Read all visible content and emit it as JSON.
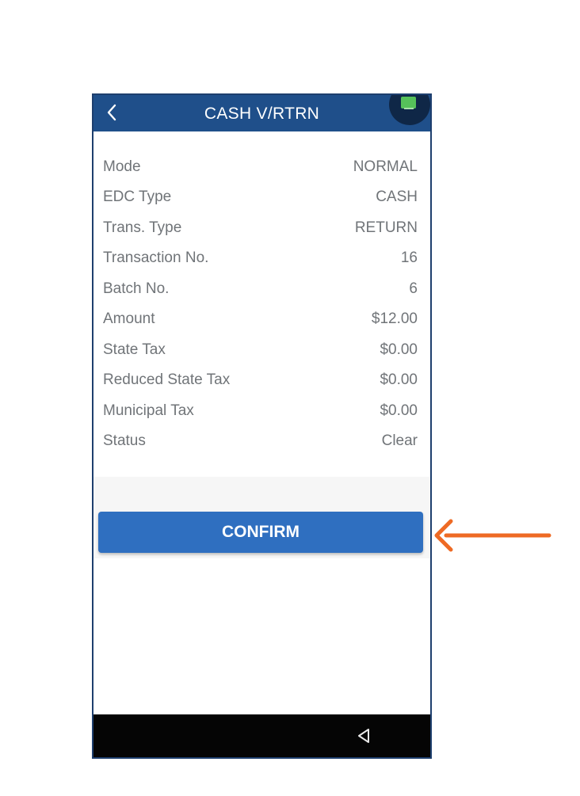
{
  "header": {
    "title": "CASH V/RTRN",
    "back_icon": "chevron-left-icon",
    "status_icon": "terminal-status-icon"
  },
  "details": [
    {
      "label": "Mode",
      "value": "NORMAL"
    },
    {
      "label": "EDC Type",
      "value": "CASH"
    },
    {
      "label": "Trans. Type",
      "value": "RETURN"
    },
    {
      "label": "Transaction No.",
      "value": "16"
    },
    {
      "label": "Batch No.",
      "value": "6"
    },
    {
      "label": "Amount",
      "value": "$12.00"
    },
    {
      "label": "State Tax",
      "value": "$0.00"
    },
    {
      "label": "Reduced State Tax",
      "value": "$0.00"
    },
    {
      "label": "Municipal Tax",
      "value": "$0.00"
    },
    {
      "label": "Status",
      "value": "Clear"
    }
  ],
  "confirm": {
    "label": "CONFIRM"
  },
  "nav": {
    "back_icon": "triangle-back-icon"
  },
  "annotation": {
    "arrow_icon": "arrow-left-icon",
    "arrow_color": "#ee6a24"
  },
  "colors": {
    "header_bg": "#1f4f8a",
    "button_bg": "#2f6fc0",
    "status_green": "#56c15a"
  }
}
